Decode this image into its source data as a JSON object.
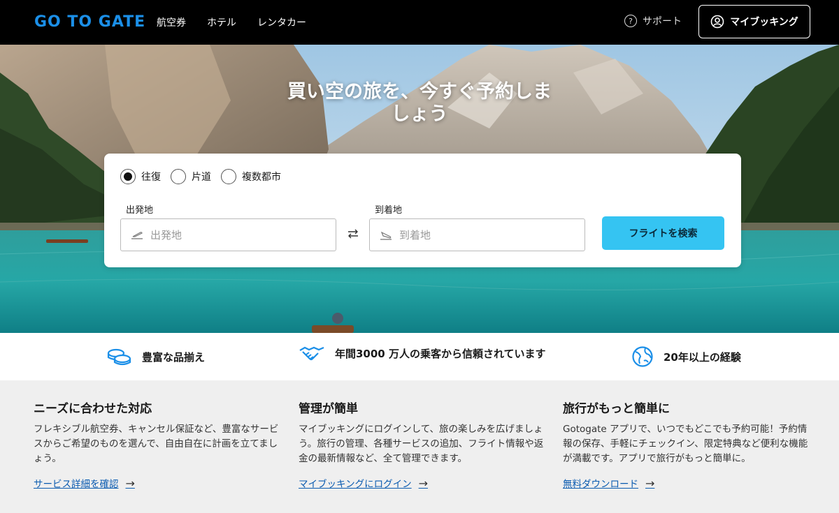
{
  "header": {
    "logo": "GO TO GATE",
    "nav": [
      "航空券",
      "ホテル",
      "レンタカー"
    ],
    "support": "サポート",
    "my_booking": "マイブッキング"
  },
  "hero": {
    "title": "買い空の旅を、今すぐ予約しましょう"
  },
  "search": {
    "trip_types": [
      {
        "label": "往復",
        "selected": true
      },
      {
        "label": "片道",
        "selected": false
      },
      {
        "label": "複数都市",
        "selected": false
      }
    ],
    "origin_label": "出発地",
    "origin_placeholder": "出発地",
    "destination_label": "到着地",
    "destination_placeholder": "到着地",
    "search_button": "フライトを検索"
  },
  "trust": [
    {
      "icon": "coins-icon",
      "text": "豊富な品揃え"
    },
    {
      "icon": "handshake-icon",
      "text": "年間3000 万人の乗客から信頼されています"
    },
    {
      "icon": "globe-icon",
      "text": "20年以上の経験"
    }
  ],
  "features": [
    {
      "title": "ニーズに合わせた対応",
      "body": "フレキシブル航空券、キャンセル保証など、豊富なサービスからご希望のものを選んで、自由自在に計画を立てましょう。",
      "link": "サービス詳細を確認"
    },
    {
      "title": "管理が簡単",
      "body": "マイブッキングにログインして、旅の楽しみを広げましょう。旅行の管理、各種サービスの追加、フライト情報や返金の最新情報など、全て管理できます。",
      "link": "マイブッキングにログイン"
    },
    {
      "title": "旅行がもっと簡単に",
      "body": "Gotogate アプリで、いつでもどこでも予約可能！予約情報の保存、手軽にチェックイン、限定特典など便利な機能が満載です。アプリで旅行がもっと簡単に。",
      "link": "無料ダウンロード"
    }
  ],
  "colors": {
    "accent": "#35c4f2",
    "brand": "#1b8fe8",
    "link": "#0a5bb0",
    "header_bg": "#000000"
  }
}
